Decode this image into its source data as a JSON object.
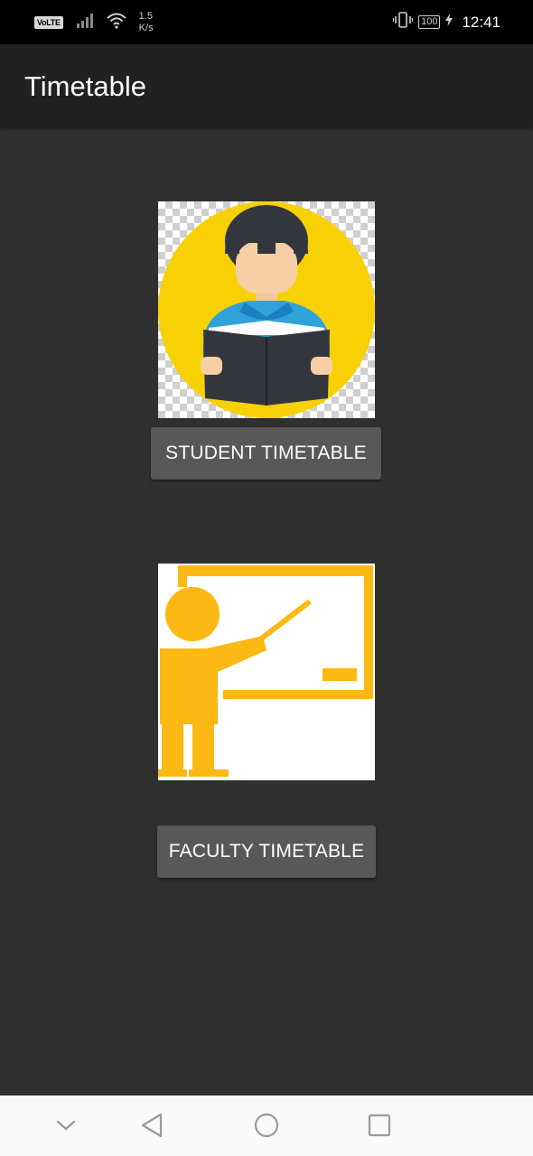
{
  "status_bar": {
    "volte": "VoLTE",
    "speed_value": "1.5",
    "speed_unit": "K/s",
    "battery": "100",
    "time": "12:41",
    "icons": [
      "signal-icon",
      "wifi-icon",
      "vibrate-icon",
      "battery-icon",
      "charging-icon"
    ]
  },
  "app_bar": {
    "title": "Timetable"
  },
  "main": {
    "student_button_label": "STUDENT TIMETABLE",
    "faculty_button_label": "FACULTY TIMETABLE",
    "student_image_icon": "student-reading-icon",
    "faculty_image_icon": "teacher-board-icon"
  },
  "nav_bar": {
    "icons": [
      "chevron-down-icon",
      "back-icon",
      "home-icon",
      "recents-icon"
    ]
  },
  "colors": {
    "background": "#303030",
    "app_bar": "#212121",
    "button": "#585858",
    "student_circle": "#F8D105",
    "faculty_figure": "#FCB813"
  }
}
